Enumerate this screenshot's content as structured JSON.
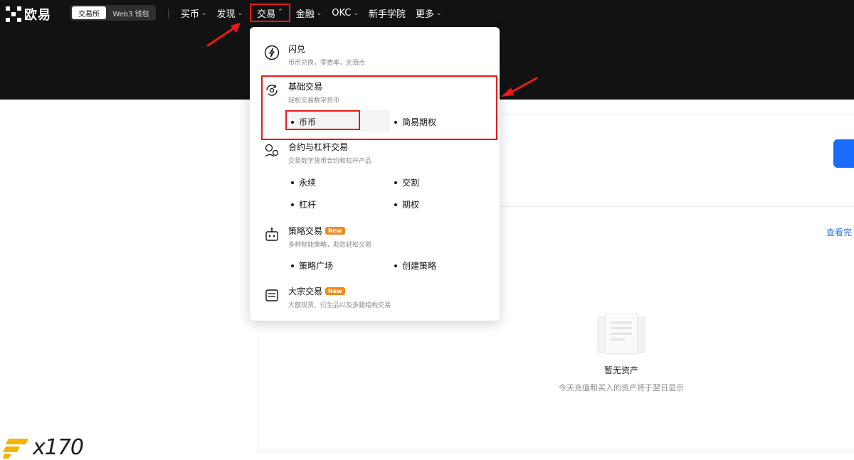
{
  "header": {
    "logo_text": "欧易",
    "switcher": {
      "exchange_label": "交易所",
      "wallet_label": "Web3 钱包"
    },
    "nav": [
      {
        "label": "买币"
      },
      {
        "label": "发现"
      },
      {
        "label": "交易"
      },
      {
        "label": "金融"
      },
      {
        "label": "OKC"
      },
      {
        "label": "新手学院"
      },
      {
        "label": "更多"
      }
    ]
  },
  "dropdown": {
    "flash": {
      "title": "闪兑",
      "desc": "币币兑换，零费率，无滑点"
    },
    "basic": {
      "title": "基础交易",
      "desc": "轻松交易数字货币",
      "items": [
        "币币",
        "简易期权"
      ]
    },
    "contract": {
      "title": "合约与杠杆交易",
      "desc": "交易数字货币合约和杠杆产品",
      "items": [
        "永续",
        "交割",
        "杠杆",
        "期权"
      ]
    },
    "strategy": {
      "title": "策略交易",
      "badge": "New",
      "desc": "多种智能策略，助您轻松交易",
      "items": [
        "策略广场",
        "创建策略"
      ]
    },
    "block": {
      "title": "大宗交易",
      "badge": "New",
      "desc": "大额现货、衍生品以及多腿结构交易"
    }
  },
  "page": {
    "view_link": "查看完",
    "empty_title": "暂无资产",
    "empty_sub": "今天充值和买入的资产将于翌日显示"
  },
  "watermark": {
    "text": "x170"
  },
  "colors": {
    "accent_red": "#e81a1a",
    "brand_blue": "#1a6bff",
    "badge_orange": "#f28a1c"
  }
}
